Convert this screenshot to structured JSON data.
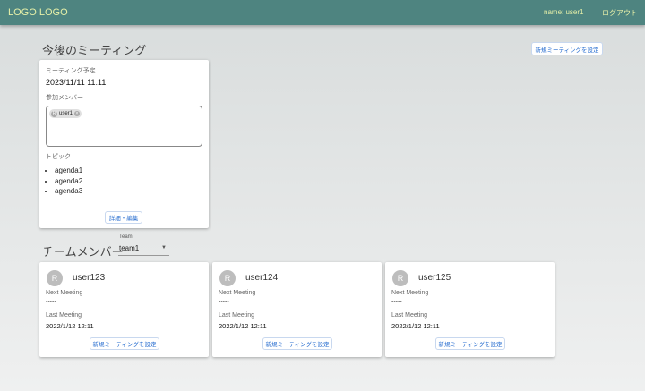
{
  "header": {
    "logo": "LOGO LOGO",
    "user": "name: user1",
    "logout": "ログアウト"
  },
  "upcoming": {
    "title": "今後のミーティング",
    "new_button": "新規ミーティングを設定",
    "card": {
      "schedule_label": "ミーティング予定",
      "datetime": "2023/11/11 11:11",
      "members_label": "参加メンバー",
      "members": [
        {
          "initial": "R",
          "name": "user1"
        }
      ],
      "topics_label": "トピック",
      "topics": [
        "agenda1",
        "agenda2",
        "agenda3"
      ],
      "edit_button": "詳細・編集"
    }
  },
  "team": {
    "title": "チームメンバー",
    "select_label": "Team",
    "select_value": "team1",
    "members": [
      {
        "initial": "R",
        "name": "user123",
        "next_label": "Next Meeting",
        "next": "-----",
        "last_label": "Last Meeting",
        "last": "2022/1/12 12:11",
        "button": "新規ミーティングを設定"
      },
      {
        "initial": "R",
        "name": "user124",
        "next_label": "Next Meeting",
        "next": "-----",
        "last_label": "Last Meeting",
        "last": "2022/1/12 12:11",
        "button": "新規ミーティングを設定"
      },
      {
        "initial": "R",
        "name": "user125",
        "next_label": "Next Meeting",
        "next": "-----",
        "last_label": "Last Meeting",
        "last": "2022/1/12 12:11",
        "button": "新規ミーティングを設定"
      }
    ]
  }
}
